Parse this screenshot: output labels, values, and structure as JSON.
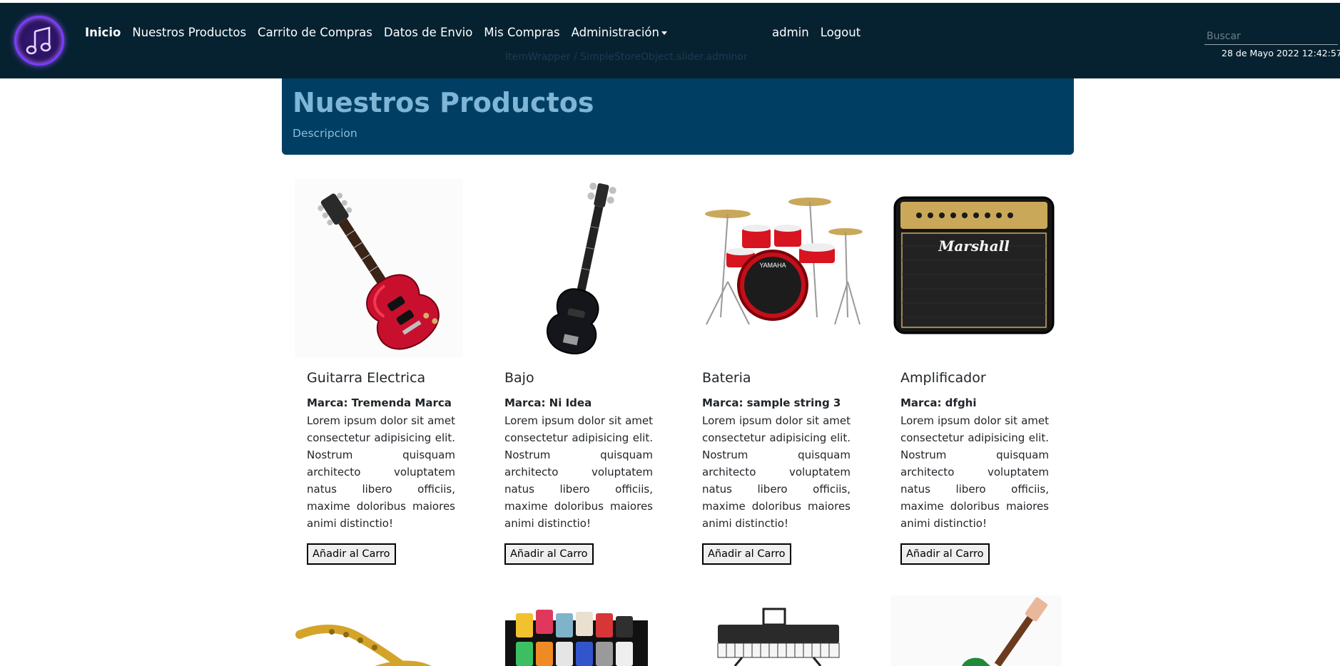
{
  "navbar": {
    "links": [
      "Inicio",
      "Nuestros Productos",
      "Carrito de Compras",
      "Datos de Envio",
      "Mis Compras",
      "Administración"
    ],
    "user": "admin",
    "logout": "Logout",
    "faded_text": "ItemWrapper / SimpleStoreObject.slider.adminor",
    "search_placeholder": "Buscar",
    "datetime": "28 de Mayo 2022 12:42:57"
  },
  "hero": {
    "title": "Nuestros Productos",
    "subtitle": "Descripcion"
  },
  "products": [
    {
      "name": "Guitarra Electrica",
      "brand": "Marca: Tremenda Marca",
      "description": "Lorem ipsum dolor sit amet consectetur adipisicing elit. Nostrum quisquam architecto voluptatem natus libero officiis, maxime doloribus maiores animi distinctio!",
      "button": "Añadir al Carro",
      "image_icon": "electric-guitar-icon"
    },
    {
      "name": "Bajo",
      "brand": "Marca: Ni Idea",
      "description": "Lorem ipsum dolor sit amet consectetur adipisicing elit. Nostrum quisquam architecto voluptatem natus libero officiis, maxime doloribus maiores animi distinctio!",
      "button": "Añadir al Carro",
      "image_icon": "bass-guitar-icon"
    },
    {
      "name": "Bateria",
      "brand": "Marca: sample string 3",
      "description": "Lorem ipsum dolor sit amet consectetur adipisicing elit. Nostrum quisquam architecto voluptatem natus libero officiis, maxime doloribus maiores animi distinctio!",
      "button": "Añadir al Carro",
      "image_icon": "drum-kit-icon"
    },
    {
      "name": "Amplificador",
      "brand": "Marca: dfghi",
      "description": "Lorem ipsum dolor sit amet consectetur adipisicing elit. Nostrum quisquam architecto voluptatem natus libero officiis, maxime doloribus maiores animi distinctio!",
      "button": "Añadir al Carro",
      "image_icon": "amplifier-icon",
      "image_text": "Marshall"
    }
  ],
  "second_row_icons": [
    "saxophone-icon",
    "pedalboard-icon",
    "keyboard-icon",
    "green-guitar-icon"
  ],
  "colors": {
    "navbar_bg": "#062231",
    "hero_bg": "#003f63",
    "hero_title": "#7fb5d6",
    "guitar_red": "#c8102e"
  }
}
